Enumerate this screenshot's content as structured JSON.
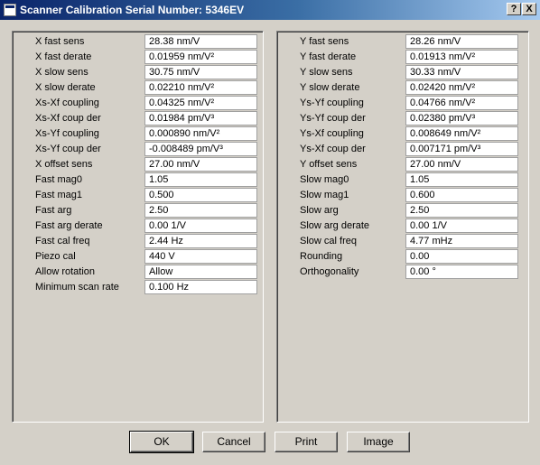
{
  "window": {
    "title": "Scanner Calibration  Serial Number: 5346EV",
    "help_label": "?",
    "close_label": "X"
  },
  "left_fields": [
    {
      "label": "X fast sens",
      "value": "28.38 nm/V"
    },
    {
      "label": "X fast derate",
      "value": "0.01959 nm/V²"
    },
    {
      "label": "X slow sens",
      "value": "30.75 nm/V"
    },
    {
      "label": "X slow derate",
      "value": "0.02210 nm/V²"
    },
    {
      "label": "Xs-Xf coupling",
      "value": "0.04325 nm/V²"
    },
    {
      "label": "Xs-Xf coup der",
      "value": "0.01984 pm/V³"
    },
    {
      "label": "Xs-Yf coupling",
      "value": "0.000890 nm/V²"
    },
    {
      "label": "Xs-Yf coup der",
      "value": "-0.008489 pm/V³"
    },
    {
      "label": "X offset sens",
      "value": "27.00 nm/V"
    },
    {
      "label": "Fast mag0",
      "value": "1.05"
    },
    {
      "label": "Fast mag1",
      "value": "0.500"
    },
    {
      "label": "Fast arg",
      "value": "2.50"
    },
    {
      "label": "Fast arg derate",
      "value": "0.00 1/V"
    },
    {
      "label": "Fast cal freq",
      "value": "2.44 Hz"
    },
    {
      "label": "Piezo cal",
      "value": "440 V"
    },
    {
      "label": "Allow rotation",
      "value": "Allow"
    },
    {
      "label": "Minimum scan rate",
      "value": "0.100 Hz"
    }
  ],
  "right_fields": [
    {
      "label": "Y fast sens",
      "value": "28.26 nm/V"
    },
    {
      "label": "Y fast derate",
      "value": "0.01913 nm/V²"
    },
    {
      "label": "Y slow sens",
      "value": "30.33 nm/V"
    },
    {
      "label": "Y slow derate",
      "value": "0.02420 nm/V²"
    },
    {
      "label": "Ys-Yf coupling",
      "value": "0.04766 nm/V²"
    },
    {
      "label": "Ys-Yf coup der",
      "value": "0.02380 pm/V³"
    },
    {
      "label": "Ys-Xf coupling",
      "value": "0.008649 nm/V²"
    },
    {
      "label": "Ys-Xf coup der",
      "value": "0.007171 pm/V³"
    },
    {
      "label": "Y offset sens",
      "value": "27.00 nm/V"
    },
    {
      "label": "Slow mag0",
      "value": "1.05"
    },
    {
      "label": "Slow mag1",
      "value": "0.600"
    },
    {
      "label": "Slow arg",
      "value": "2.50"
    },
    {
      "label": "Slow arg derate",
      "value": "0.00 1/V"
    },
    {
      "label": "Slow cal freq",
      "value": "4.77 mHz"
    },
    {
      "label": "Rounding",
      "value": "0.00"
    },
    {
      "label": "Orthogonality",
      "value": "0.00 °"
    }
  ],
  "buttons": {
    "ok": "OK",
    "cancel": "Cancel",
    "print": "Print",
    "image": "Image"
  }
}
